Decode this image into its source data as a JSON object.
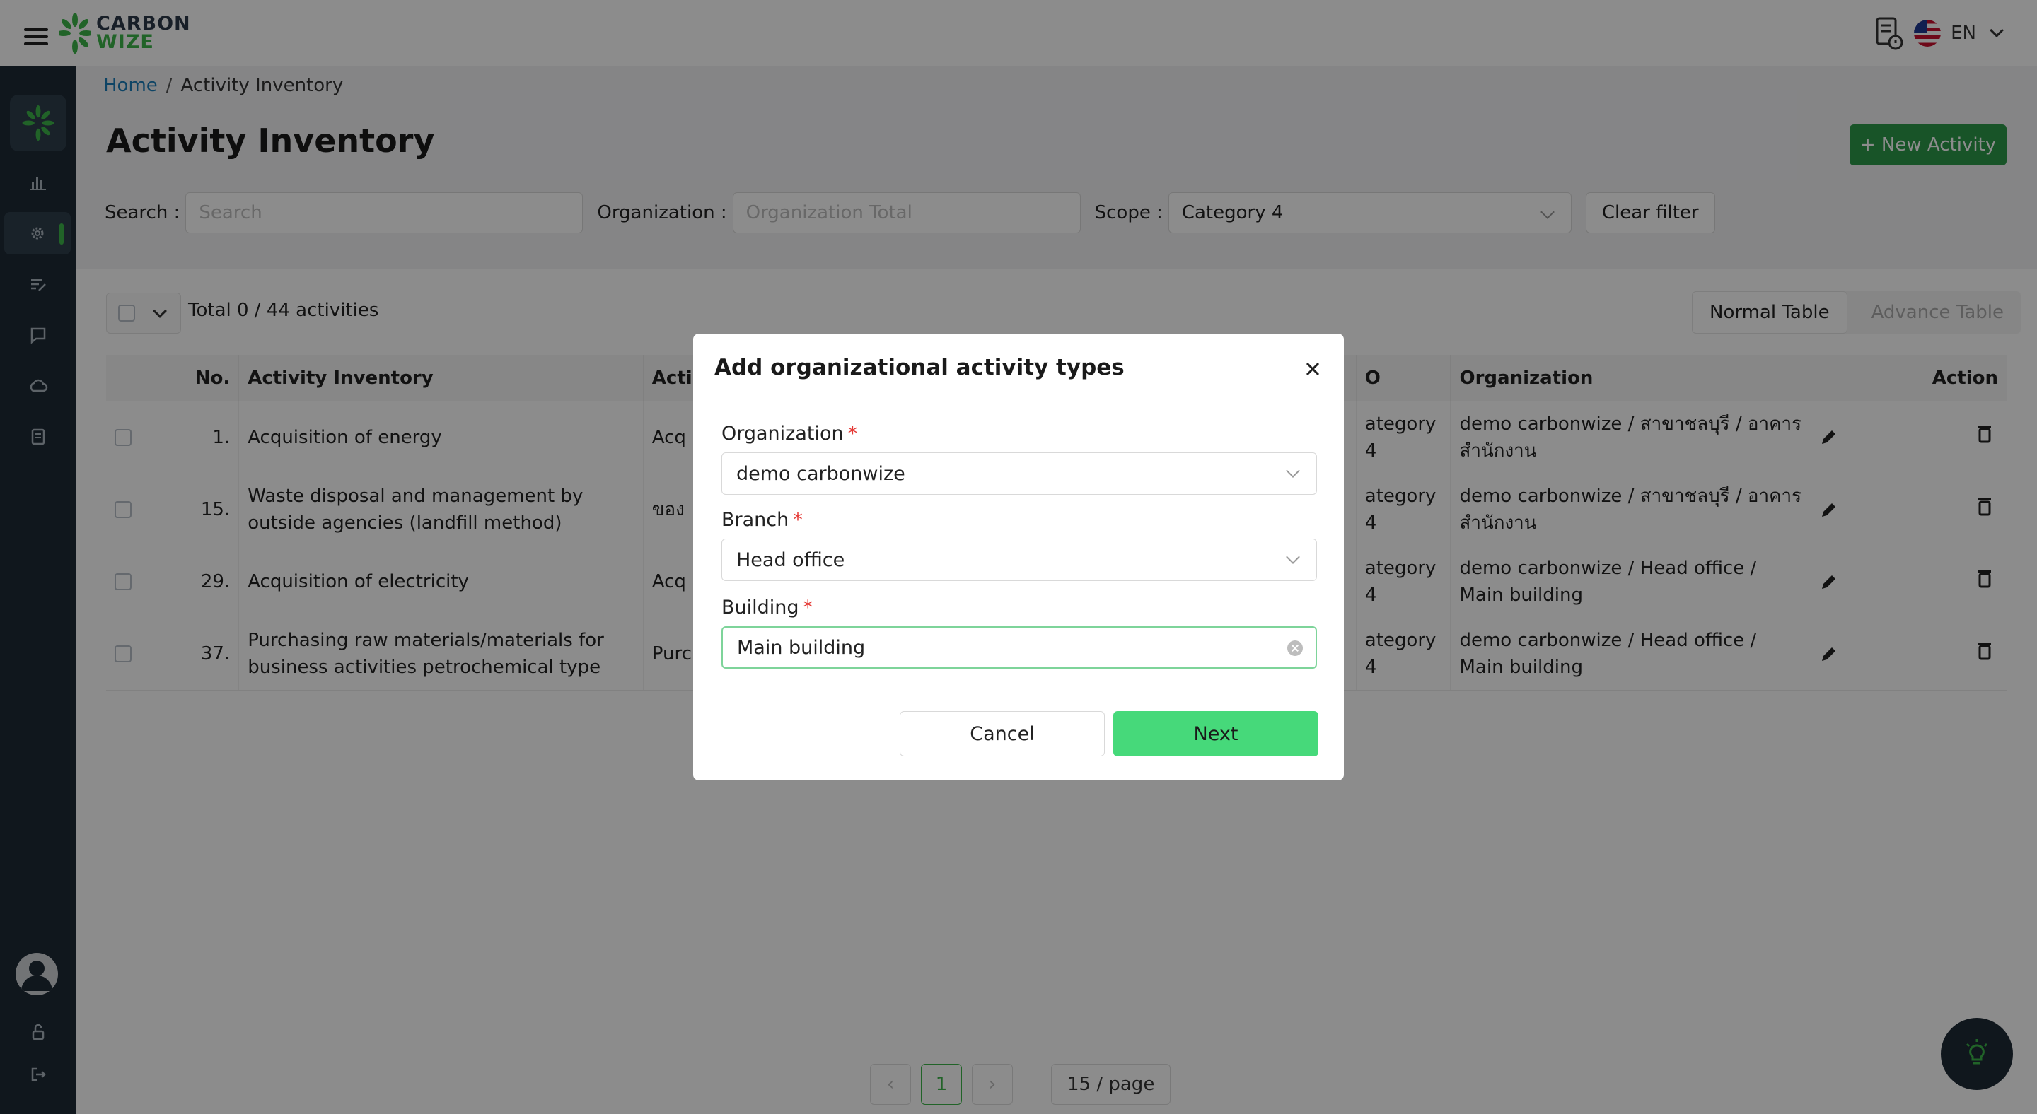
{
  "brand": {
    "line1": "CARBON",
    "line2": "WIZE"
  },
  "header": {
    "language": "EN"
  },
  "breadcrumb": {
    "home": "Home",
    "separator": "/",
    "current": "Activity Inventory"
  },
  "page": {
    "title": "Activity Inventory",
    "new_button": "+ New Activity"
  },
  "filters": {
    "search_label": "Search :",
    "search_placeholder": "Search",
    "org_label": "Organization :",
    "org_placeholder": "Organization Total",
    "scope_label": "Scope :",
    "scope_value": "Category 4",
    "clear": "Clear filter"
  },
  "table_controls": {
    "total": "Total 0 / 44 activities",
    "normal": "Normal Table",
    "advance": "Advance Table"
  },
  "table": {
    "headers": {
      "no": "No.",
      "activity": "Activity Inventory",
      "acti": "Acti",
      "iso": "O",
      "org": "Organization",
      "action": "Action"
    },
    "rows": [
      {
        "no": "1.",
        "activity": "Acquisition of energy",
        "acti": "Acq",
        "iso": "ategory 4",
        "org": "demo carbonwize / สาขาชลบุรี / อาคารสำนักงาน"
      },
      {
        "no": "15.",
        "activity": "Waste disposal and management by outside agencies (landfill method)",
        "acti": "ของ",
        "iso": "ategory 4",
        "org": "demo carbonwize / สาขาชลบุรี / อาคารสำนักงาน"
      },
      {
        "no": "29.",
        "activity": "Acquisition of electricity",
        "acti": "Acq",
        "iso": "ategory 4",
        "org": "demo carbonwize / Head office / Main building"
      },
      {
        "no": "37.",
        "activity": "Purchasing raw materials/materials for business activities petrochemical type",
        "acti": "Purc acti",
        "iso": "ategory 4",
        "org": "demo carbonwize / Head office / Main building"
      }
    ]
  },
  "pagination": {
    "current": "1",
    "page_size": "15 / page"
  },
  "modal": {
    "title": "Add organizational activity types",
    "org_label": "Organization",
    "org_value": "demo carbonwize",
    "branch_label": "Branch",
    "branch_value": "Head office",
    "building_label": "Building",
    "building_value": "Main building",
    "required_mark": "*",
    "cancel": "Cancel",
    "next": "Next"
  },
  "colors": {
    "brand_green": "#3cb54a",
    "sidebar": "#1e2a36",
    "primary_button": "#2d9a4a",
    "next_button": "#46d97a"
  }
}
